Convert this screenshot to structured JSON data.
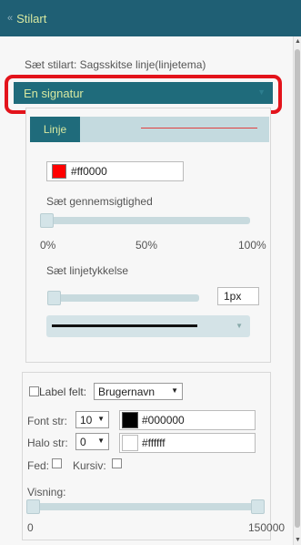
{
  "header": {
    "back_glyph": "«",
    "title": "Stilart"
  },
  "panel": {
    "stilart_label": "Sæt stilart: Sagsskitse linje(linjetema)",
    "signature_select": "En signatur",
    "tab_label": "Linje",
    "color": {
      "hex": "#ff0000",
      "swatch": "#ff0000"
    },
    "opacity": {
      "label": "Sæt gennemsigtighed",
      "ticks": [
        "0%",
        "50%",
        "100%"
      ],
      "value_percent": 0
    },
    "thickness": {
      "label": "Sæt linjetykkelse",
      "value": "1px"
    }
  },
  "label_section": {
    "label_field_text": "Label felt:",
    "label_field_value": "Brugernavn",
    "font_size_label": "Font str:",
    "font_size_value": "10",
    "font_color": {
      "hex": "#000000",
      "swatch": "#000000"
    },
    "halo_size_label": "Halo str:",
    "halo_size_value": "0",
    "halo_color": {
      "hex": "#ffffff",
      "swatch": "#ffffff"
    },
    "bold_label": "Fed:",
    "italic_label": "Kursiv:",
    "visibility_label": "Visning:",
    "range_min": "0",
    "range_max": "150000"
  },
  "colors": {
    "header_bg": "#1f5f74",
    "accent_text": "#d7e8a0",
    "highlight": "#e3131b"
  }
}
